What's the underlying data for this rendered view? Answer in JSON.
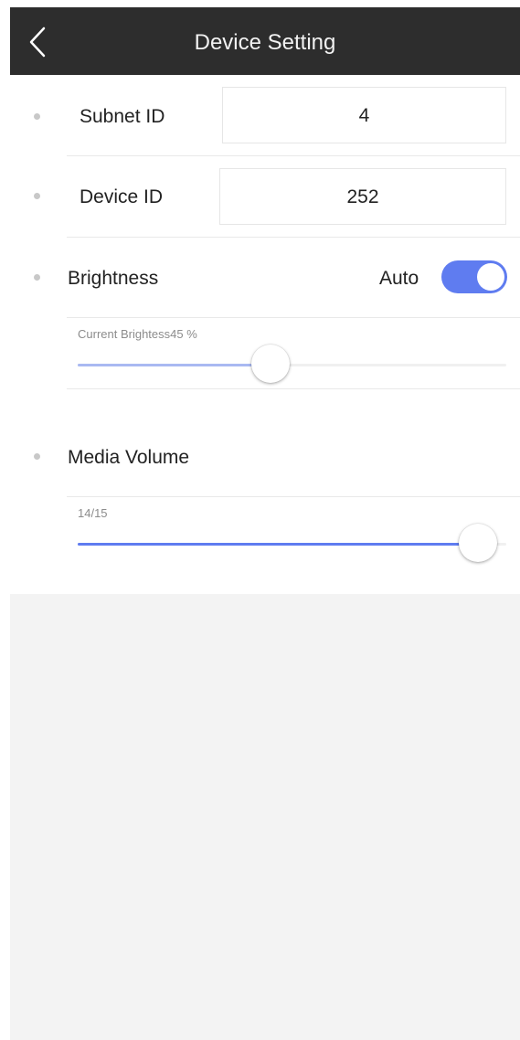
{
  "header": {
    "title": "Device Setting",
    "back_icon": "chevron-left-icon"
  },
  "subnet": {
    "label": "Subnet ID",
    "value": "4"
  },
  "device": {
    "label": "Device ID",
    "value": "252"
  },
  "brightness": {
    "label": "Brightness",
    "auto_label": "Auto",
    "auto_enabled": true,
    "caption": "Current Brightess45 %",
    "level_percent": 45
  },
  "volume": {
    "label": "Media Volume",
    "caption": "14/15",
    "current": 14,
    "max": 15
  },
  "colors": {
    "accent": "#5f7cf0",
    "brightness_fill": "#a9b9f2",
    "header_bg": "#2d2d2d",
    "empty_bg": "#f3f3f3"
  }
}
